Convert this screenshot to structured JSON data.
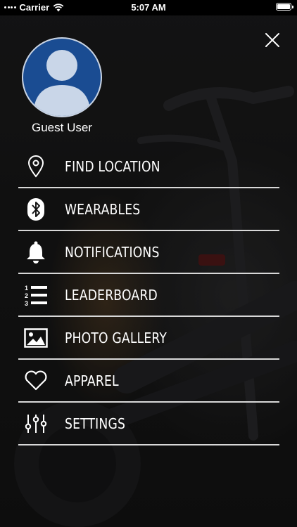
{
  "status_bar": {
    "carrier": "Carrier",
    "time": "5:07 AM",
    "icons": [
      "signal-dots-icon",
      "wifi-icon",
      "battery-icon"
    ]
  },
  "drawer": {
    "close_icon": "close-icon",
    "user": {
      "avatar_icon": "default-avatar-icon",
      "name": "Guest User",
      "avatar_color": "#1a4c92"
    },
    "items": [
      {
        "label": "FIND LOCATION",
        "icon": "location-pin-icon"
      },
      {
        "label": "WEARABLES",
        "icon": "bluetooth-icon"
      },
      {
        "label": "NOTIFICATIONS",
        "icon": "bell-icon"
      },
      {
        "label": "LEADERBOARD",
        "icon": "ranked-list-icon"
      },
      {
        "label": "PHOTO GALLERY",
        "icon": "photo-icon"
      },
      {
        "label": "APPAREL",
        "icon": "heart-icon"
      },
      {
        "label": "SETTINGS",
        "icon": "sliders-icon"
      }
    ]
  }
}
